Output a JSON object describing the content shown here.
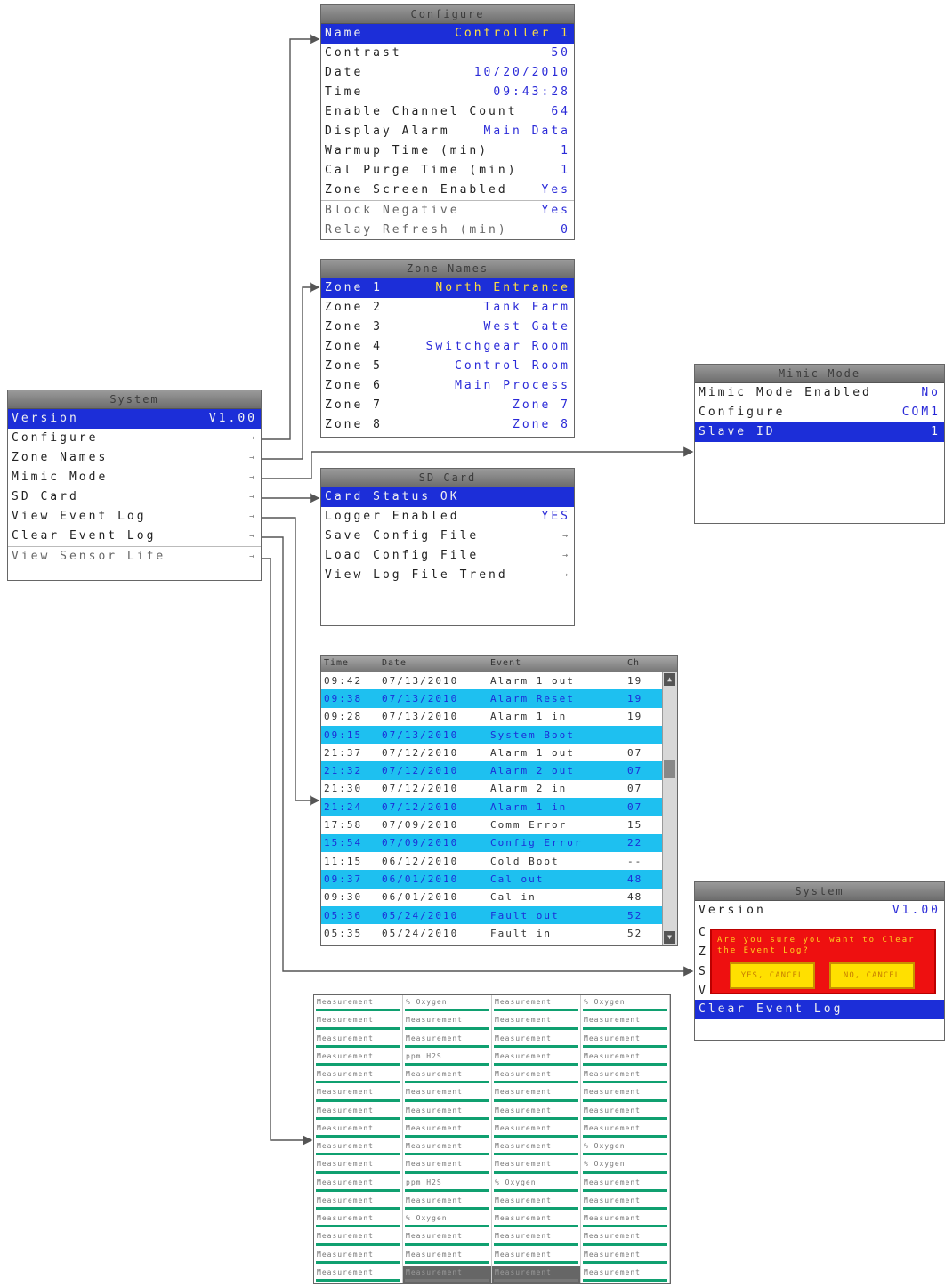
{
  "system": {
    "title": "System",
    "items": [
      {
        "label": "Version",
        "value": "V1.00"
      },
      {
        "label": "Configure",
        "value": "→"
      },
      {
        "label": "Zone Names",
        "value": "→"
      },
      {
        "label": "Mimic Mode",
        "value": "→"
      },
      {
        "label": "SD Card",
        "value": "→"
      },
      {
        "label": "View Event Log",
        "value": "→"
      },
      {
        "label": "Clear Event Log",
        "value": "→"
      },
      {
        "label": "View Sensor Life",
        "value": "→"
      }
    ]
  },
  "configure": {
    "title": "Configure",
    "items": [
      {
        "label": "Name",
        "value": "Controller 1"
      },
      {
        "label": "Contrast",
        "value": "50"
      },
      {
        "label": "Date",
        "value": "10/20/2010"
      },
      {
        "label": "Time",
        "value": "09:43:28"
      },
      {
        "label": "Enable Channel Count",
        "value": "64"
      },
      {
        "label": "Display Alarm",
        "value": "Main Data"
      },
      {
        "label": "Warmup Time (min)",
        "value": "1"
      },
      {
        "label": "Cal Purge Time (min)",
        "value": "1"
      },
      {
        "label": "Zone Screen Enabled",
        "value": "Yes"
      },
      {
        "label": "Block Negative",
        "value": "Yes"
      },
      {
        "label": "Relay Refresh (min)",
        "value": "0"
      }
    ]
  },
  "zone_names": {
    "title": "Zone Names",
    "items": [
      {
        "label": "Zone 1",
        "value": "North Entrance"
      },
      {
        "label": "Zone 2",
        "value": "Tank Farm"
      },
      {
        "label": "Zone 3",
        "value": "West Gate"
      },
      {
        "label": "Zone 4",
        "value": "Switchgear Room"
      },
      {
        "label": "Zone 5",
        "value": "Control Room"
      },
      {
        "label": "Zone 6",
        "value": "Main Process"
      },
      {
        "label": "Zone 7",
        "value": "Zone 7"
      },
      {
        "label": "Zone 8",
        "value": "Zone 8"
      }
    ]
  },
  "mimic_mode": {
    "title": "Mimic Mode",
    "items": [
      {
        "label": "Mimic Mode Enabled",
        "value": "No"
      },
      {
        "label": "Configure",
        "value": "COM1"
      },
      {
        "label": "Slave ID",
        "value": "1"
      }
    ]
  },
  "sd_card": {
    "title": "SD Card",
    "items": [
      {
        "label": "Card Status OK",
        "value": ""
      },
      {
        "label": "Logger Enabled",
        "value": "YES"
      },
      {
        "label": "Save Config File",
        "value": "→"
      },
      {
        "label": "Load Config File",
        "value": "→"
      },
      {
        "label": "View Log File Trend",
        "value": "→"
      }
    ]
  },
  "event_log": {
    "headers": [
      "Time",
      "Date",
      "Event",
      "Ch"
    ],
    "rows": [
      {
        "time": "09:42",
        "date": "07/13/2010",
        "event": "Alarm 1 out",
        "ch": "19"
      },
      {
        "time": "09:38",
        "date": "07/13/2010",
        "event": "Alarm Reset",
        "ch": "19"
      },
      {
        "time": "09:28",
        "date": "07/13/2010",
        "event": "Alarm 1 in",
        "ch": "19"
      },
      {
        "time": "09:15",
        "date": "07/13/2010",
        "event": "System Boot",
        "ch": ""
      },
      {
        "time": "21:37",
        "date": "07/12/2010",
        "event": "Alarm 1 out",
        "ch": "07"
      },
      {
        "time": "21:32",
        "date": "07/12/2010",
        "event": "Alarm 2 out",
        "ch": "07"
      },
      {
        "time": "21:30",
        "date": "07/12/2010",
        "event": "Alarm 2 in",
        "ch": "07"
      },
      {
        "time": "21:24",
        "date": "07/12/2010",
        "event": "Alarm 1 in",
        "ch": "07"
      },
      {
        "time": "17:58",
        "date": "07/09/2010",
        "event": "Comm Error",
        "ch": "15"
      },
      {
        "time": "15:54",
        "date": "07/09/2010",
        "event": "Config Error",
        "ch": "22"
      },
      {
        "time": "11:15",
        "date": "06/12/2010",
        "event": "Cold Boot",
        "ch": "--"
      },
      {
        "time": "09:37",
        "date": "06/01/2010",
        "event": "Cal out",
        "ch": "48"
      },
      {
        "time": "09:30",
        "date": "06/01/2010",
        "event": "Cal in",
        "ch": "48"
      },
      {
        "time": "05:36",
        "date": "05/24/2010",
        "event": "Fault out",
        "ch": "52"
      },
      {
        "time": "05:35",
        "date": "05/24/2010",
        "event": "Fault in",
        "ch": "52"
      }
    ]
  },
  "clear_event_log": {
    "title": "System",
    "version_label": "Version",
    "version_value": "V1.00",
    "side_letters": [
      "C",
      "Z",
      "S",
      "V"
    ],
    "question": "Are you sure you want to Clear the Event Log?",
    "yes_label": "YES, CANCEL",
    "no_label": "NO, CANCEL",
    "selected_label": "Clear Event Log"
  },
  "sensor_life": {
    "cells": [
      "Measurement",
      "% Oxygen",
      "Measurement",
      "% Oxygen",
      "Measurement",
      "Measurement",
      "Measurement",
      "Measurement",
      "Measurement",
      "Measurement",
      "Measurement",
      "Measurement",
      "Measurement",
      "ppm H2S",
      "Measurement",
      "Measurement",
      "Measurement",
      "Measurement",
      "Measurement",
      "Measurement",
      "Measurement",
      "Measurement",
      "Measurement",
      "Measurement",
      "Measurement",
      "Measurement",
      "Measurement",
      "Measurement",
      "Measurement",
      "Measurement",
      "Measurement",
      "Measurement",
      "Measurement",
      "Measurement",
      "Measurement",
      "% Oxygen",
      "Measurement",
      "Measurement",
      "Measurement",
      "% Oxygen",
      "Measurement",
      "ppm H2S",
      "% Oxygen",
      "Measurement",
      "Measurement",
      "Measurement",
      "Measurement",
      "Measurement",
      "Measurement",
      "% Oxygen",
      "Measurement",
      "Measurement",
      "Measurement",
      "Measurement",
      "Measurement",
      "Measurement",
      "Measurement",
      "Measurement",
      "Measurement",
      "Measurement",
      "Measurement",
      "Measurement",
      "Measurement",
      "Measurement"
    ]
  },
  "colors": {
    "selection": "#1c2ed8",
    "value_text": "#2b2bd8",
    "log_highlight": "#1ec0f0",
    "dialog": "#ee1010",
    "dialog_button": "#ffe000",
    "sensor_bar": "#10a070"
  }
}
